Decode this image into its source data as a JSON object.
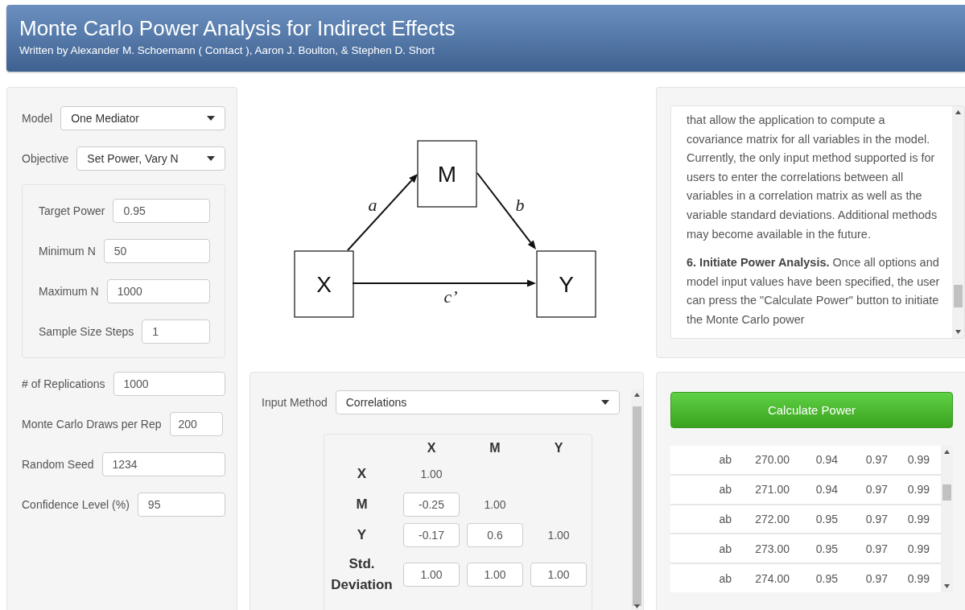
{
  "header": {
    "title": "Monte Carlo Power Analysis for Indirect Effects",
    "subtitle": "Written by Alexander M. Schoemann ( Contact ), Aaron J. Boulton, & Stephen D. Short"
  },
  "settings": {
    "selects": [
      {
        "label": "Model",
        "value": "One Mediator"
      },
      {
        "label": "Objective",
        "value": "Set Power, Vary N"
      }
    ],
    "power_fields": [
      {
        "label": "Target Power",
        "value": "0.95"
      },
      {
        "label": "Minimum N",
        "value": "50"
      },
      {
        "label": "Maximum N",
        "value": "1000"
      },
      {
        "label": "Sample Size Steps",
        "value": "1"
      }
    ],
    "fields": [
      {
        "label": "# of Replications",
        "value": "1000"
      },
      {
        "label": "Monte Carlo Draws per Rep",
        "value": "200"
      },
      {
        "label": "Random Seed",
        "value": "1234"
      },
      {
        "label": "Confidence Level (%)",
        "value": "95"
      }
    ]
  },
  "diagram": {
    "nodes": [
      {
        "label": "X"
      },
      {
        "label": "M"
      },
      {
        "label": "Y"
      }
    ],
    "paths": [
      {
        "label": "a"
      },
      {
        "label": "b"
      },
      {
        "label": "c’"
      }
    ]
  },
  "input_method": {
    "label": "Input Method",
    "value": "Correlations"
  },
  "matrix": {
    "columns": [
      "X",
      "M",
      "Y"
    ],
    "rows": [
      {
        "label": "X",
        "cells": [
          {
            "kind": "text",
            "value": "1.00"
          }
        ]
      },
      {
        "label": "M",
        "cells": [
          {
            "kind": "input",
            "value": "-0.25"
          },
          {
            "kind": "text",
            "value": "1.00"
          }
        ]
      },
      {
        "label": "Y",
        "cells": [
          {
            "kind": "input",
            "value": "-0.17"
          },
          {
            "kind": "input",
            "value": "0.6"
          },
          {
            "kind": "text",
            "value": "1.00"
          }
        ]
      },
      {
        "label": "Std. Deviation",
        "cells": [
          {
            "kind": "input",
            "value": "1.00"
          },
          {
            "kind": "input",
            "value": "1.00"
          },
          {
            "kind": "input",
            "value": "1.00"
          }
        ]
      }
    ]
  },
  "help": {
    "paragraphs": [
      "that allow the application to compute a covariance matrix for all variables in the model. Currently, the only input method supported is for users to enter the correlations between all variables in a correlation matrix as well as the variable standard deviations. Additional methods may become available in the future.",
      "**6. Initiate Power Analysis.** Once all options and model input values have been specified, the user can press the \"Calculate Power\" button to initiate the Monte Carlo power"
    ]
  },
  "calculate_button": "Calculate Power",
  "results": {
    "rows": [
      [
        "ab",
        "270.00",
        "0.94",
        "0.97",
        "0.99"
      ],
      [
        "ab",
        "271.00",
        "0.94",
        "0.97",
        "0.99"
      ],
      [
        "ab",
        "272.00",
        "0.95",
        "0.97",
        "0.99"
      ],
      [
        "ab",
        "273.00",
        "0.95",
        "0.97",
        "0.99"
      ],
      [
        "ab",
        "274.00",
        "0.95",
        "0.97",
        "0.99"
      ]
    ]
  }
}
